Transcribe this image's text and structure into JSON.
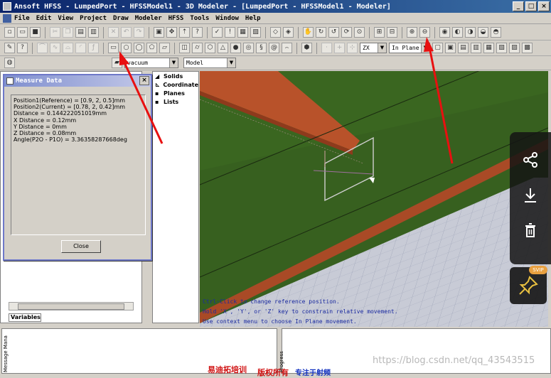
{
  "window": {
    "title": "Ansoft HFSS - LumpedPort - HFSSModel1 - 3D Modeler - [LumpedPort - HFSSModel1 - Modeler]",
    "buttons": [
      "_",
      "□",
      "×"
    ]
  },
  "menu": [
    "File",
    "Edit",
    "View",
    "Project",
    "Draw",
    "Modeler",
    "HFSS",
    "Tools",
    "Window",
    "Help"
  ],
  "toolbar": {
    "plane_select": "ZX",
    "plane_mode": "In Plane",
    "material_select": "vacuum",
    "model_select": "Model"
  },
  "tree": {
    "items": [
      "Solids",
      "Coordinate",
      "Planes",
      "Lists"
    ]
  },
  "left_panel": {
    "tab_label": "Variables"
  },
  "measure_dialog": {
    "title": "Measure Data",
    "lines": [
      "Position1(Reference) = [0.9, 2, 0.5]mm",
      "Position2(Current) = [0.78, 2, 0.42]mm",
      "Distance = 0.144222051019mm",
      "X Distance = 0.12mm",
      "Y Distance = 0mm",
      "Z Distance = 0.08mm",
      "Angle(P2O - P1O) = 3.36358287668deg"
    ],
    "close_label": "Close"
  },
  "viewport": {
    "hints": [
      "Ctrl-Click to change reference position.",
      "Hold 'X', 'Y', or 'Z' key to constrain relative movement.",
      "Use context menu to choose In Plane movement."
    ],
    "colors": {
      "ground": "#37601f",
      "trace": "#b8522a",
      "substrate": "#c8cbd6",
      "hint_text": "#1a2aa0"
    }
  },
  "bottom": {
    "vlabel1": "Message Mana",
    "vlabel2": "Progress",
    "red_text_1": "易迪拓培训",
    "red_text_2": "版权所有",
    "blue_text": "专注于射频",
    "watermark": "https://blog.csdn.net/qq_43543515"
  },
  "overlay": {
    "svip_label": "SVIP"
  },
  "annotations": {
    "arrow_color": "#e81010"
  }
}
